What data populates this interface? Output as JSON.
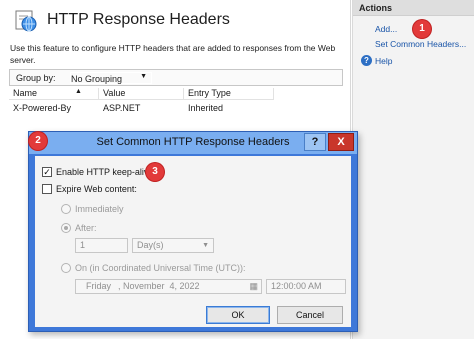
{
  "page": {
    "title": "HTTP Response Headers",
    "description": "Use this feature to configure HTTP headers that are added to responses from the Web server.",
    "groupby_label": "Group by:",
    "groupby_value": "No Grouping",
    "columns": [
      "Name",
      "Value",
      "Entry Type"
    ],
    "rows": [
      {
        "name": "X-Powered-By",
        "value": "ASP.NET",
        "entry_type": "Inherited"
      }
    ]
  },
  "actions": {
    "header": "Actions",
    "links": [
      "Add...",
      "Set Common Headers..."
    ],
    "help": "Help"
  },
  "callouts": [
    "1",
    "2",
    "3"
  ],
  "dialog": {
    "title": "Set Common HTTP Response Headers",
    "help_button": "?",
    "close_button": "X",
    "keepalive_label": "Enable HTTP keep-alive",
    "keepalive_checked": true,
    "expire_label": "Expire Web content:",
    "expire_checked": false,
    "radio_immediately": "Immediately",
    "radio_after": "After:",
    "after_value": "1",
    "after_unit": "Day(s)",
    "radio_on": "On (in Coordinated Universal Time (UTC)):",
    "on_day": "Friday",
    "on_date": ", November  4, 2022",
    "on_time": "12:00:00 AM",
    "ok": "OK",
    "cancel": "Cancel"
  },
  "colors": {
    "dialog_border": "#3e78d9",
    "dialog_titlebar": "#7aaef0",
    "close_button": "#c9362b",
    "callout": "#e23a3a",
    "link": "#1a55a8"
  }
}
